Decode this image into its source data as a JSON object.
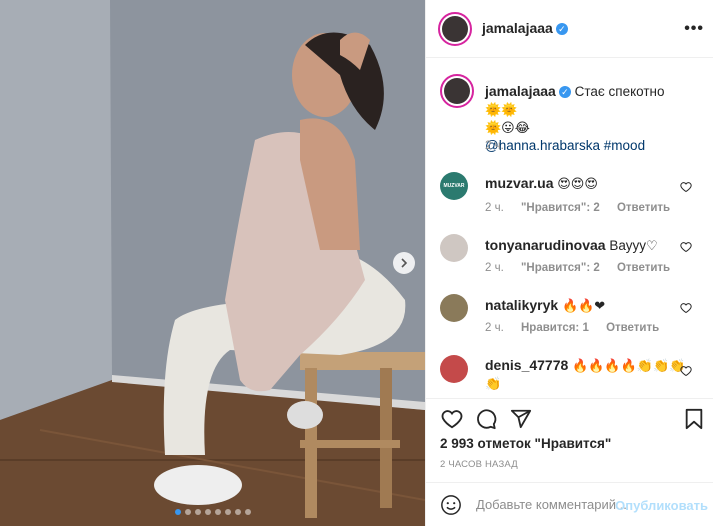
{
  "post": {
    "author": "jamalajaaa",
    "caption": "Стає спекотно",
    "caption_emojis_line1": "🌞🌞",
    "caption_emojis_line2": "🌞😛😂",
    "caption_link": "@hanna.hrabarska",
    "caption_hashtag": "#mood",
    "caption_time": "2 ч.",
    "likes": "2 993 отметок \"Нравится\"",
    "posted_ago": "2 ЧАСОВ НАЗАД",
    "carousel": {
      "total": 8,
      "active_index": 0
    }
  },
  "comments": [
    {
      "user": "muzvar.ua",
      "text": "",
      "emojis": "😍😍😍",
      "time": "2 ч.",
      "likes": "\"Нравится\": 2",
      "reply": "Ответить",
      "avatar_label": "MUZVAR"
    },
    {
      "user": "tonyanarudinovaa",
      "text": "Вауyy",
      "emojis": "♡",
      "time": "2 ч.",
      "likes": "\"Нравится\": 2",
      "reply": "Ответить"
    },
    {
      "user": "natalikyryk",
      "text": "",
      "emojis": "🔥🔥❤",
      "time": "2 ч.",
      "likes": "Нравится: 1",
      "reply": "Ответить"
    },
    {
      "user": "denis_47778",
      "text": "",
      "emojis": "🔥🔥🔥🔥👏👏👏",
      "emojis_line2": "👏",
      "time": "",
      "likes": "",
      "reply": ""
    }
  ],
  "comment_box": {
    "placeholder": "Добавьте комментарий...",
    "publish": "Опубликовать"
  },
  "colors": {
    "link": "#00376b",
    "publish": "#b2dffc",
    "verified": "#3897f0",
    "muzvar_avatar": "#2b7a6f"
  },
  "icons": [
    "more-icon",
    "verified-icon",
    "heart-icon",
    "comment-icon",
    "share-icon",
    "bookmark-icon",
    "smile-icon",
    "chevron-right-icon"
  ]
}
